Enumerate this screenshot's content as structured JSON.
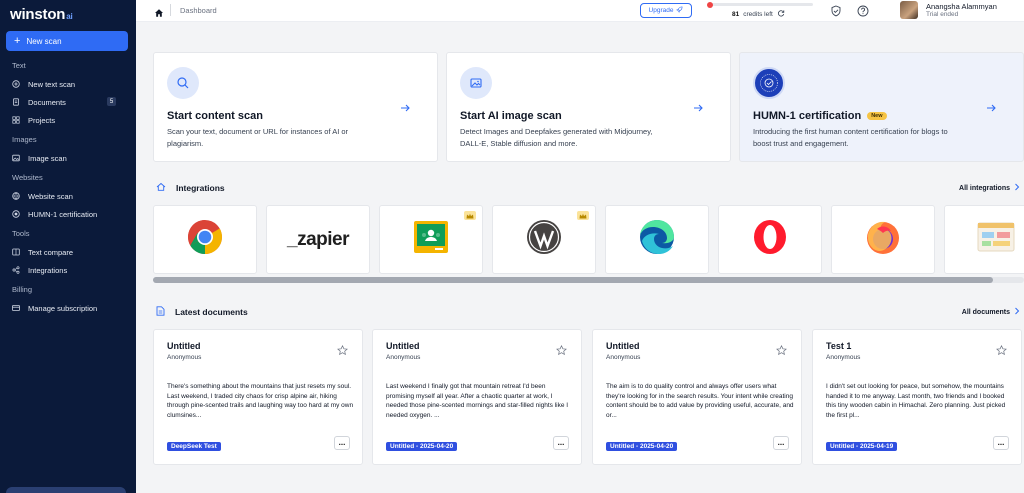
{
  "sidebar": {
    "logo": "winston",
    "logo_suffix": "ai",
    "new_scan_label": "New scan",
    "sections": {
      "text": "Text",
      "images": "Images",
      "websites": "Websites",
      "tools": "Tools",
      "billing": "Billing"
    },
    "items": {
      "new_text_scan": "New text scan",
      "documents": "Documents",
      "documents_count": "5",
      "projects": "Projects",
      "image_scan": "Image scan",
      "website_scan": "Website scan",
      "humn_certification": "HUMN-1 certification",
      "text_compare": "Text compare",
      "integrations": "Integrations",
      "manage_subscription": "Manage subscription"
    }
  },
  "topbar": {
    "breadcrumb": "Dashboard",
    "upgrade_label": "Upgrade",
    "credits_value": "81",
    "credits_label": "credits left",
    "credits_fraction": 0.02,
    "user_name": "Anangsha Alammyan",
    "user_status": "Trial ended"
  },
  "cards": [
    {
      "title": "Start content scan",
      "desc": "Scan your text, document or URL for instances of AI or plagiarism."
    },
    {
      "title": "Start AI image scan",
      "desc": "Detect Images and Deepfakes generated with Midjourney, DALL-E, Stable diffusion and more."
    },
    {
      "title": "HUMN-1 certification",
      "badge": "New",
      "desc": "Introducing the first human content certification for blogs to boost trust and engagement."
    }
  ],
  "integrations": {
    "title": "Integrations",
    "all_link": "All integrations",
    "zapier_text": "_zapier"
  },
  "documents": {
    "title": "Latest documents",
    "all_link": "All documents",
    "items": [
      {
        "title": "Untitled",
        "author": "Anonymous",
        "text": "There's something about the mountains that just resets my soul. Last weekend, I traded city chaos for crisp alpine air, hiking through pine-scented trails and laughing way too hard at my own clumsines...",
        "tag": "DeepSeek Test"
      },
      {
        "title": "Untitled",
        "author": "Anonymous",
        "text": "Last weekend I finally got that mountain retreat I'd been promising myself all year. After a chaotic quarter at work, I needed those pine-scented mornings and star-filled nights like I needed oxygen. ...",
        "tag": "Untitled - 2025-04-20"
      },
      {
        "title": "Untitled",
        "author": "Anonymous",
        "text": "The aim is to do quality control and always offer users what they're looking for in the search results. Your intent while creating content should be to add value by providing useful, accurate, and or...",
        "tag": "Untitled - 2025-04-20"
      },
      {
        "title": "Test 1",
        "author": "Anonymous",
        "text": "I didn't set out looking for peace, but somehow, the mountains handed it to me anyway. Last month, two friends and I booked this tiny wooden cabin in Himachal. Zero planning. Just picked the first pl...",
        "tag": "Untitled - 2025-04-19"
      }
    ],
    "more_label": "..."
  },
  "colors": {
    "sidebar_bg": "#0b1a3a",
    "accent": "#2f6bf4",
    "tag_blue": "#2f4fe0",
    "new_badge": "#f6c445"
  }
}
